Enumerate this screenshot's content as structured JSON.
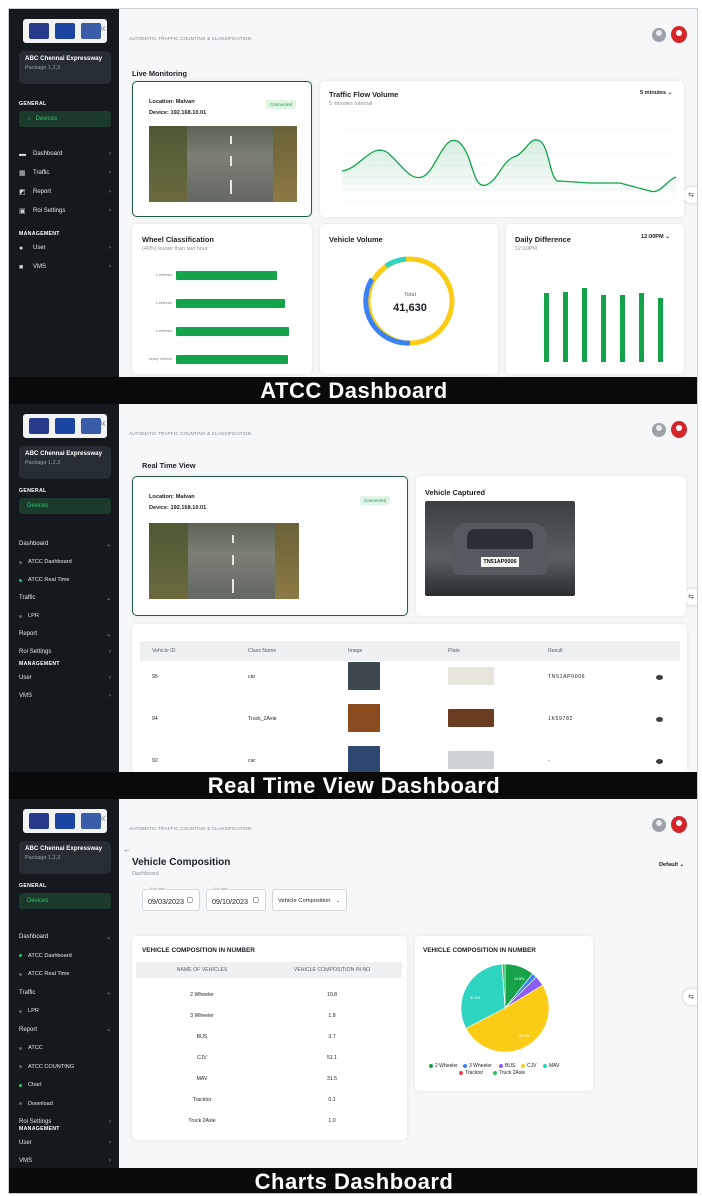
{
  "app": {
    "topline": "AUTOMATIC TRAFFIC COUNTING & CLASSIFICATION",
    "package_name": "ABC Chennai Expressway",
    "package_sub": "Package 1,2,3",
    "general": "GENERAL",
    "management": "MANAGEMENT",
    "devices": "Devices",
    "collapse": "«",
    "settings_glyph": "⇆",
    "cal_glyph": "▢"
  },
  "panel1": {
    "nav": [
      {
        "label": "Dashboard",
        "icon": "dashboard-icon",
        "glyph": "▬"
      },
      {
        "label": "Traffic",
        "icon": "traffic-icon",
        "glyph": "▦"
      },
      {
        "label": "Report",
        "icon": "report-icon",
        "glyph": "◩"
      },
      {
        "label": "Roi Settings",
        "icon": "roi-icon",
        "glyph": "▣"
      }
    ],
    "mgmt": [
      {
        "label": "User",
        "icon": "user-icon",
        "glyph": "●"
      },
      {
        "label": "VMS",
        "icon": "vms-icon",
        "glyph": "■"
      }
    ],
    "page_title": "Live Monitoring",
    "location": "Location: Malvan",
    "device": "Device: 192.168.10.01",
    "connected": "Connected",
    "flow": {
      "title": "Traffic Flow Volume",
      "subtitle": "5 minutes Interval",
      "dropdown": "5 minutes"
    },
    "wheel": {
      "title": "Wheel Classification",
      "subtitle": "(40%) lesser than last hour",
      "rows": [
        {
          "label": "2 wheeler",
          "value": 0.78
        },
        {
          "label": "3 wheeler",
          "value": 0.84
        },
        {
          "label": "4 wheeler",
          "value": 0.87
        },
        {
          "label": "heavy Vehicle",
          "value": 0.86
        }
      ]
    },
    "volume": {
      "title": "Vehicle Volume",
      "total_label": "Total",
      "total_value": "41,630"
    },
    "daily": {
      "title": "Daily Difference",
      "subtitle": "12:00PM",
      "dropdown": "12:00PM",
      "bars": [
        0.78,
        0.8,
        0.84,
        0.76,
        0.76,
        0.78,
        0.73
      ]
    },
    "banner": "ATCC Dashboard"
  },
  "panel2": {
    "nav": [
      {
        "label": "Dashboard",
        "type": "group"
      },
      {
        "label": "ATCC Dashboard",
        "type": "sub"
      },
      {
        "label": "ATCC Real Time",
        "type": "sub",
        "active": true
      },
      {
        "label": "Traffic",
        "type": "group"
      },
      {
        "label": "LPR",
        "type": "sub"
      },
      {
        "label": "Report",
        "type": "group"
      },
      {
        "label": "Roi Settings",
        "type": "group"
      }
    ],
    "mgmt": [
      "User",
      "VMS"
    ],
    "page_title": "Real Time View",
    "location": "Location: Malvan",
    "device": "Device: 192.168.10.01",
    "connected": "Connected",
    "captured_title": "Vehicle Captured",
    "plate_text": "TN51AP0006",
    "table": {
      "headers": [
        "Vehicle ID",
        "Class Name",
        "Image",
        "Plate",
        "Result"
      ],
      "rows": [
        {
          "id": "95",
          "class": "car",
          "result": "TN51AP0006"
        },
        {
          "id": "94",
          "class": "Truck_2Axle",
          "result": "1K59782"
        },
        {
          "id": "92",
          "class": "car",
          "result": "-"
        }
      ]
    },
    "banner": "Real Time View Dashboard"
  },
  "panel3": {
    "nav": [
      {
        "label": "Dashboard",
        "type": "group"
      },
      {
        "label": "ATCC Dashboard",
        "type": "sub",
        "active": true
      },
      {
        "label": "ATCC Real Time",
        "type": "sub"
      },
      {
        "label": "Traffic",
        "type": "group"
      },
      {
        "label": "LPR",
        "type": "sub"
      },
      {
        "label": "Report",
        "type": "group"
      },
      {
        "label": "ATCC",
        "type": "sub"
      },
      {
        "label": "ATCC COUNTING",
        "type": "sub"
      },
      {
        "label": "Chart",
        "type": "sub",
        "active": true
      },
      {
        "label": "Download",
        "type": "sub"
      },
      {
        "label": "Roi Settings",
        "type": "group"
      }
    ],
    "mgmt": [
      "User",
      "VMS"
    ],
    "back": "←",
    "page_title": "Vehicle Composition",
    "breadcrumb": "Dashboard",
    "default_dropdown": "Default",
    "start_label": "Start date",
    "start_value": "09/03/2023",
    "end_label": "End date",
    "end_value": "09/10/2023",
    "composition_select": "Vehicle Composition",
    "table_title": "VEHICLE COMPOSITION IN NUMBER",
    "table_headers": [
      "NAME OF VEHICLES",
      "VEHICLE COMPOSITION IN NO"
    ],
    "rows": [
      {
        "name": "2 Wheeler",
        "value": "10.8"
      },
      {
        "name": "3 Wheeler",
        "value": "1.8"
      },
      {
        "name": "BUS",
        "value": "3.7"
      },
      {
        "name": "CJV",
        "value": "51.1"
      },
      {
        "name": "MAV",
        "value": "31.5"
      },
      {
        "name": "Tracktor",
        "value": "0.1"
      },
      {
        "name": "Truck 2Axle",
        "value": "1.0"
      }
    ],
    "pie_title": "VEHICLE COMPOSITION IN NUMBER",
    "pie_labels": {
      "two_wheeler": "10.8%",
      "mav": "31.5%",
      "cjv": "51.1%"
    },
    "legend": [
      {
        "name": "2 Wheeler",
        "color": "#16a34a"
      },
      {
        "name": "3 Wheeler",
        "color": "#3b82f6"
      },
      {
        "name": "BUS",
        "color": "#8b5cf6"
      },
      {
        "name": "CJV",
        "color": "#facc15"
      },
      {
        "name": "MAV",
        "color": "#2dd4bf"
      },
      {
        "name": "Tracktor",
        "color": "#ef4444"
      },
      {
        "name": "Truck 2Axle",
        "color": "#22c55e"
      }
    ],
    "banner": "Charts Dashboard"
  },
  "colors": {
    "accent": "#13a34a",
    "sidebar": "#14191e",
    "selected_border": "#1e5c45",
    "brand_red": "#d3252a"
  }
}
